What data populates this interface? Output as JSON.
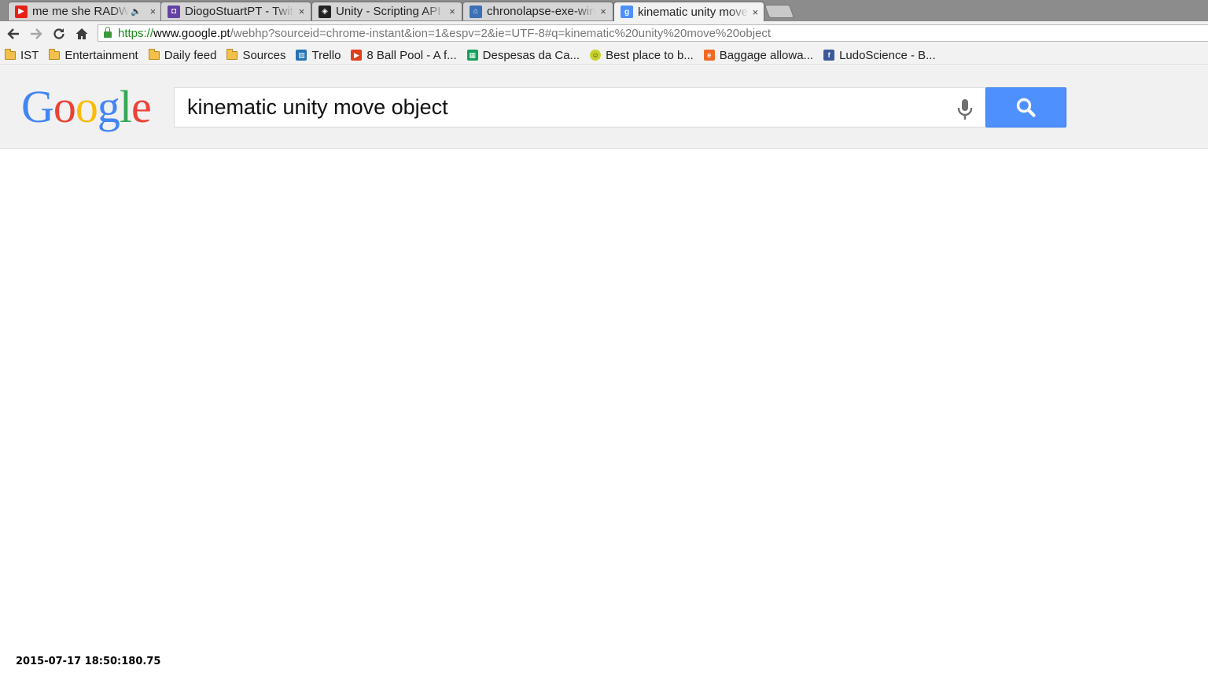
{
  "browser": {
    "tabs": [
      {
        "title": "me me she RADWIMPS",
        "icon": "youtube-icon",
        "color": "#e62117",
        "audible": true
      },
      {
        "title": "DiogoStuartPT - Twitch",
        "icon": "twitch-icon",
        "color": "#6441a5",
        "audible": false
      },
      {
        "title": "Unity - Scripting API",
        "icon": "unity-icon",
        "color": "#222222",
        "audible": false
      },
      {
        "title": "chronolapse-exe-win",
        "icon": "chronolapse-icon",
        "color": "#3b6fb6",
        "audible": false
      },
      {
        "title": "kinematic unity move object",
        "icon": "google-icon",
        "color": "#4d90fe",
        "audible": false,
        "active": true
      }
    ],
    "close_glyph": "×",
    "audio_glyph": "🔈",
    "url": {
      "scheme": "https://",
      "host": "www.google.pt",
      "rest": "/webhp?sourceid=chrome-instant&ion=1&espv=2&ie=UTF-8#q=kinematic%20unity%20move%20object"
    },
    "bookmarks": [
      {
        "label": "IST",
        "icon": "folder-icon"
      },
      {
        "label": "Entertainment",
        "icon": "folder-icon"
      },
      {
        "label": "Daily feed",
        "icon": "folder-icon"
      },
      {
        "label": "Sources",
        "icon": "folder-icon"
      },
      {
        "label": "Trello",
        "icon": "trello-icon",
        "color": "#2672b5"
      },
      {
        "label": "8 Ball Pool - A f...",
        "icon": "play-icon",
        "color": "#e2401c"
      },
      {
        "label": "Despesas da Ca...",
        "icon": "sheets-icon",
        "color": "#16a05d"
      },
      {
        "label": "Best place to b...",
        "icon": "smiley-icon",
        "color": "#c8d22c"
      },
      {
        "label": "Baggage allowa...",
        "icon": "e-icon",
        "color": "#f26b22"
      },
      {
        "label": "LudoScience - B...",
        "icon": "facebook-icon",
        "color": "#3b5998"
      }
    ]
  },
  "google": {
    "logo_letters": [
      {
        "ch": "G",
        "color": "#4285f4"
      },
      {
        "ch": "o",
        "color": "#ea4335"
      },
      {
        "ch": "o",
        "color": "#fbbc05"
      },
      {
        "ch": "g",
        "color": "#4285f4"
      },
      {
        "ch": "l",
        "color": "#34a853"
      },
      {
        "ch": "e",
        "color": "#ea4335"
      }
    ],
    "query": "kinematic unity move object",
    "search_button_color": "#4d90fe"
  },
  "overlay": {
    "timestamp": "2015-07-17 18:50:180.75"
  }
}
